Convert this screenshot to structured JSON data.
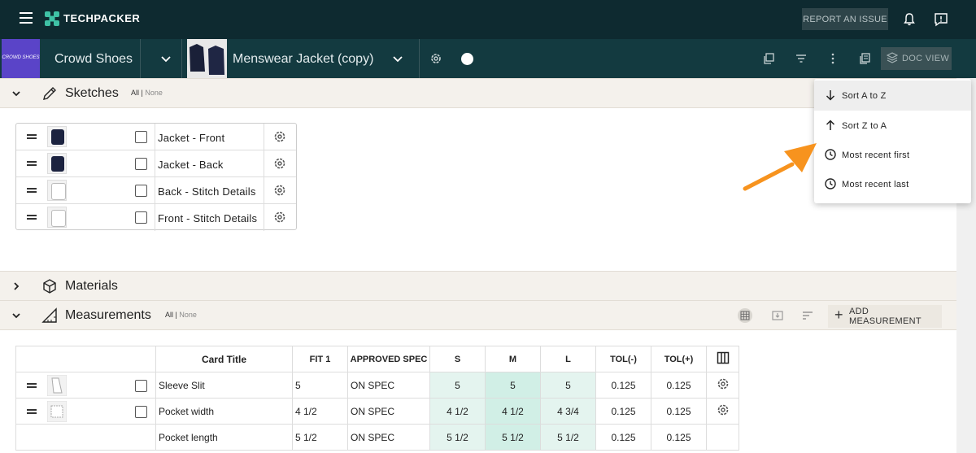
{
  "app": {
    "brand": "TECHPACKER",
    "report_issue": "REPORT AN ISSUE"
  },
  "subbar": {
    "brand_tile": "CROWD SHOES",
    "company": "Crowd Shoes",
    "product": "Menswear Jacket (copy)",
    "doc_view": "DOC VIEW"
  },
  "sections": {
    "sketches": {
      "title": "Sketches",
      "all": "All",
      "sep": " | ",
      "none": "None"
    },
    "materials": {
      "title": "Materials"
    },
    "measurements": {
      "title": "Measurements",
      "all": "All",
      "sep": " | ",
      "none": "None",
      "add_label": "ADD MEASUREMENT"
    }
  },
  "sketch_rows": [
    {
      "label": "Jacket - Front",
      "thumb": "dark"
    },
    {
      "label": "Jacket - Back",
      "thumb": "dark"
    },
    {
      "label": "Back - Stitch Details",
      "thumb": "light"
    },
    {
      "label": "Front - Stitch Details",
      "thumb": "light"
    }
  ],
  "measurements": {
    "headers": {
      "title": "Card Title",
      "fit1": "FIT 1",
      "approved": "APPROVED SPEC",
      "s": "S",
      "m": "M",
      "l": "L",
      "tol_minus": "TOL(-)",
      "tol_plus": "TOL(+)"
    },
    "rows": [
      {
        "title": "Sleeve Slit",
        "fit1": "5",
        "approved": "ON SPEC",
        "s": "5",
        "m": "5",
        "l": "5",
        "tol_minus": "0.125",
        "tol_plus": "0.125"
      },
      {
        "title": "Pocket width",
        "fit1": "4 1/2",
        "approved": "ON SPEC",
        "s": "4 1/2",
        "m": "4 1/2",
        "l": "4 3/4",
        "tol_minus": "0.125",
        "tol_plus": "0.125"
      },
      {
        "title": "Pocket length",
        "fit1": "5 1/2",
        "approved": "ON SPEC",
        "s": "5 1/2",
        "m": "5 1/2",
        "l": "5 1/2",
        "tol_minus": "0.125",
        "tol_plus": "0.125"
      }
    ]
  },
  "sort_menu": {
    "items": [
      {
        "label": "Sort A to Z",
        "icon": "arrow-down-icon"
      },
      {
        "label": "Sort Z to A",
        "icon": "arrow-up-icon"
      },
      {
        "label": "Most recent first",
        "icon": "clock-icon"
      },
      {
        "label": "Most recent last",
        "icon": "clock-icon"
      }
    ]
  },
  "colors": {
    "topbar": "#0e2a30",
    "subbar": "#133a40",
    "brand_tile": "#5a44c8",
    "accent_arrow": "#f7931e",
    "size_highlight": "#d1efe6"
  }
}
